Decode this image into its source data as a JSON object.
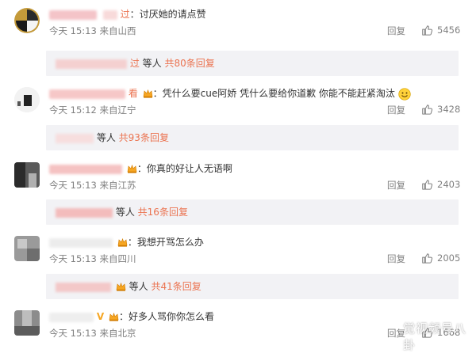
{
  "comments": [
    {
      "name_visible": "过",
      "text": "：讨厌她的请点赞",
      "time": "今天 15:13 来自山西",
      "reply": "回复",
      "likes": "5456",
      "sub": {
        "name_visible": "过",
        "others": "等人",
        "count": "共80条回复"
      }
    },
    {
      "name_visible": "看",
      "text": "：凭什么要cue阿娇 凭什么要给你道歉 你能不能赶紧淘汰",
      "time": "今天 15:12 来自辽宁",
      "reply": "回复",
      "likes": "3428",
      "sub": {
        "name_visible": "",
        "others": "等人",
        "count": "共93条回复"
      }
    },
    {
      "name_visible": "",
      "text": "：你真的好让人无语啊",
      "time": "今天 15:13 来自江苏",
      "reply": "回复",
      "likes": "2403",
      "sub": {
        "name_visible": "",
        "others": "等人",
        "count": "共16条回复"
      }
    },
    {
      "name_visible": "",
      "text": "：我想开骂怎么办",
      "time": "今天 15:13 来自四川",
      "reply": "回复",
      "likes": "2005",
      "sub": {
        "name_visible": "",
        "others": "等人",
        "count": "共41条回复"
      }
    },
    {
      "name_visible": "V",
      "text": "：好多人骂你你怎么看",
      "time": "今天 15:13 来自北京",
      "reply": "回复",
      "likes": "1668"
    }
  ],
  "watermark": "觉视频号八卦",
  "colors": {
    "link": "#eb7350",
    "meta": "#808080",
    "subbox": "#f2f2f5"
  },
  "icons": {
    "like": "thumbs-up-icon",
    "badge": "vip-crown-icon",
    "emoji": "smile-emoji-icon"
  }
}
